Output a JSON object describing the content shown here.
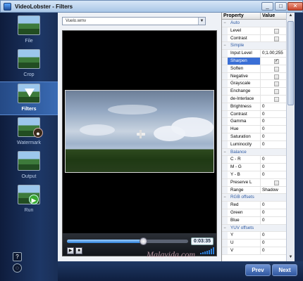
{
  "window": {
    "title": "VideoLobster - Filters"
  },
  "nav": {
    "items": [
      {
        "label": "File"
      },
      {
        "label": "Crop"
      },
      {
        "label": "Filters"
      },
      {
        "label": "Watermark"
      },
      {
        "label": "Output"
      },
      {
        "label": "Run"
      }
    ],
    "help_label": "?"
  },
  "editor": {
    "file_name": "Vuelo.wmv",
    "timecode": "0:03:35",
    "progress": 0.63
  },
  "properties": {
    "headers": {
      "property": "Property",
      "value": "Value"
    },
    "rows": [
      {
        "type": "group",
        "name": "Auto",
        "expander": "−"
      },
      {
        "type": "check",
        "name": "Level",
        "checked": false
      },
      {
        "type": "check",
        "name": "Contrast",
        "checked": false
      },
      {
        "type": "group",
        "name": "Simple",
        "expander": "−"
      },
      {
        "type": "text",
        "name": "Input Level",
        "value": "0;1.00;255"
      },
      {
        "type": "check",
        "name": "Sharpen",
        "checked": true,
        "selected": true
      },
      {
        "type": "check",
        "name": "Soften",
        "checked": false
      },
      {
        "type": "check",
        "name": "Negative",
        "checked": false
      },
      {
        "type": "check",
        "name": "Grayscale",
        "checked": false
      },
      {
        "type": "check",
        "name": "Enchange",
        "checked": false
      },
      {
        "type": "check",
        "name": "de-Interlace",
        "checked": false
      },
      {
        "type": "text",
        "name": "Brightness",
        "value": "0"
      },
      {
        "type": "text",
        "name": "Contrast",
        "value": "0"
      },
      {
        "type": "text",
        "name": "Gamma",
        "value": "0"
      },
      {
        "type": "text",
        "name": "Hue",
        "value": "0"
      },
      {
        "type": "text",
        "name": "Saturation",
        "value": "0"
      },
      {
        "type": "text",
        "name": "Luminocity",
        "value": "0"
      },
      {
        "type": "group",
        "name": "Balance",
        "expander": "−"
      },
      {
        "type": "text",
        "name": "C - R",
        "value": "0"
      },
      {
        "type": "text",
        "name": "M - G",
        "value": "0"
      },
      {
        "type": "text",
        "name": "Y - B",
        "value": "0"
      },
      {
        "type": "check",
        "name": "Preserve L",
        "checked": false
      },
      {
        "type": "text",
        "name": "Range",
        "value": "Shadow"
      },
      {
        "type": "group",
        "name": "RGB offsets",
        "expander": "−"
      },
      {
        "type": "text",
        "name": "Red",
        "value": "0"
      },
      {
        "type": "text",
        "name": "Green",
        "value": "0"
      },
      {
        "type": "text",
        "name": "Blue",
        "value": "0"
      },
      {
        "type": "group",
        "name": "YUV offsets",
        "expander": "−"
      },
      {
        "type": "text",
        "name": "Y",
        "value": "0"
      },
      {
        "type": "text",
        "name": "U",
        "value": "0"
      },
      {
        "type": "text",
        "name": "V",
        "value": "0"
      }
    ]
  },
  "footer": {
    "prev_label": "Prev",
    "next_label": "Next",
    "watermark_text": "Malavida.com"
  }
}
